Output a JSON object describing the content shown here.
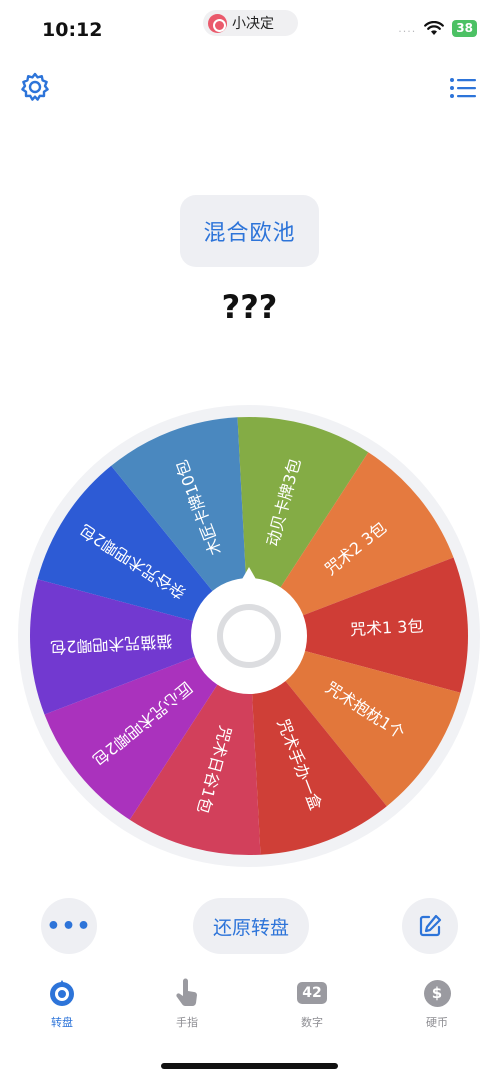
{
  "status_bar": {
    "time": "10:12",
    "app_name": "小决定",
    "signal": "....",
    "battery": "38"
  },
  "toolbar": {
    "settings_icon": "gear-icon",
    "list_icon": "list-icon"
  },
  "pool_button": {
    "label": "混合欧池"
  },
  "result": {
    "text": "???"
  },
  "wheel": {
    "segments": [
      {
        "label": "杂谷咒术吧唧2包",
        "color": "#2d5bd5"
      },
      {
        "label": "木匠卡牌10包",
        "color": "#4a88bf"
      },
      {
        "label": "动贝卡牌3包",
        "color": "#84ac45"
      },
      {
        "label": "咒术2 3包",
        "color": "#e57a3f"
      },
      {
        "label": "咒术1 3包",
        "color": "#cf3d36"
      },
      {
        "label": "咒术抱枕1个",
        "color": "#e2773b"
      },
      {
        "label": "咒术手办一盒",
        "color": "#cf3f37"
      },
      {
        "label": "咒术日谷1包",
        "color": "#d2405b"
      },
      {
        "label": "匠心咒术吧唧2包",
        "color": "#aa32bd"
      },
      {
        "label": "猫猫咒术吧唧2包",
        "color": "#7239d0"
      }
    ]
  },
  "controls": {
    "more_label": "•••",
    "restore_label": "还原转盘",
    "edit_icon": "edit-icon"
  },
  "tabs": [
    {
      "label": "转盘",
      "icon": "wheel-icon",
      "active": true
    },
    {
      "label": "手指",
      "icon": "finger-icon",
      "active": false
    },
    {
      "label": "数字",
      "icon": "number-icon",
      "badge": "42",
      "active": false
    },
    {
      "label": "硬币",
      "icon": "coin-icon",
      "badge": "$",
      "active": false
    }
  ],
  "colors": {
    "accent": "#2d74d9",
    "button_bg": "#eeeff3",
    "inactive_tab": "#8e8e93"
  }
}
